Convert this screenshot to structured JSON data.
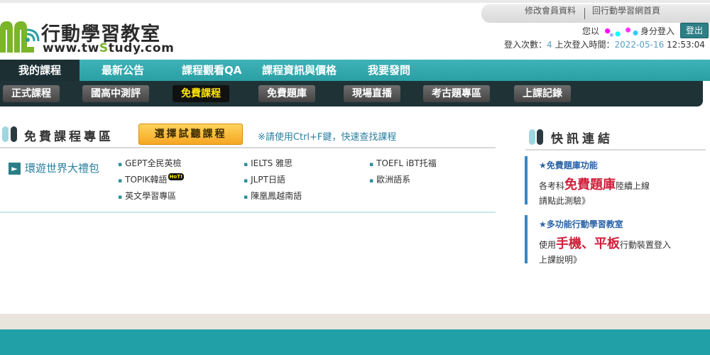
{
  "brand": {
    "title": "行動學習教室",
    "url_prefix": "www.tw",
    "url_accent": "S",
    "url_suffix": "tudy.com",
    "logo_colors": {
      "green": "#7ab52a",
      "teal": "#2a9fa4"
    }
  },
  "account": {
    "edit_link": "修改會員資料",
    "home_link": "回行動學習網首頁",
    "greeting_prefix": "您以",
    "greeting_suffix": "身分登入",
    "logout_label": "登出",
    "login_count_label": "登入次數：",
    "login_count": "4",
    "last_login_label": " 上次登入時間：",
    "last_login_date": "2022-05-16",
    "last_login_time": " 12:53:04"
  },
  "nav_main": {
    "items": [
      {
        "label": "我的課程"
      },
      {
        "label": "最新公告"
      },
      {
        "label": "課程觀看QA"
      },
      {
        "label": "課程資訊與價格"
      },
      {
        "label": "我要發問"
      }
    ]
  },
  "nav_sub": {
    "items": [
      {
        "label": "正式課程"
      },
      {
        "label": "國高中測評"
      },
      {
        "label": "免費課程"
      },
      {
        "label": "免費題庫"
      },
      {
        "label": "現場直播"
      },
      {
        "label": "考古題專區"
      },
      {
        "label": "上課記錄"
      }
    ]
  },
  "free_courses": {
    "title": "免費課程專區",
    "trial_button": "選擇試聽課程",
    "hint": "※請使用Ctrl+F鍵，快速查找課程",
    "package_label": "環遊世界大禮包",
    "courses": [
      {
        "label": "GEPT全民英檢"
      },
      {
        "label": "IELTS 雅思"
      },
      {
        "label": "TOEFL iBT托福"
      },
      {
        "label": "TOPIK韓語"
      },
      {
        "label": "JLPT日語"
      },
      {
        "label": "歐洲語系"
      },
      {
        "label": "英文學習專區"
      },
      {
        "label": "陳凰鳳越南語"
      }
    ],
    "hot_badge": "HoT!"
  },
  "news": {
    "title": "快訊連結",
    "items": [
      {
        "title": "★免費題庫功能",
        "desc_prefix": "各考科",
        "desc_big": "免費題庫",
        "desc_suffix": "陸續上線",
        "link": "請點此測驗》"
      },
      {
        "title": "★多功能行動學習教室",
        "desc_prefix": "使用",
        "desc_big": "手機、平板",
        "desc_suffix": "行動裝置登入",
        "link": "上課說明》"
      }
    ]
  }
}
